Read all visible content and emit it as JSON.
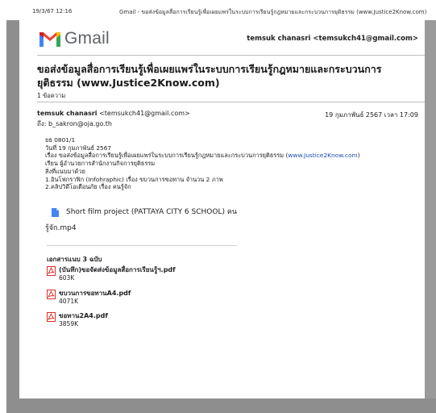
{
  "print_header": {
    "timestamp": "19/3/67 12:16",
    "title": "Gmail - ขอส่งข้อมูลสื่อการเรียนรู้เพื่อเผยแพร่ในระบบการเรียนรู้กฎหมายและกระบวนการยุติธรรม (www.Justice2Know.com)"
  },
  "gmail": {
    "brand": "Gmail",
    "account": "temsuk chanasri <temsukch41@gmail.com>"
  },
  "thread": {
    "subject": "ขอส่งข้อมูลสื่อการเรียนรู้เพื่อเผยแพร่ในระบบการเรียนรู้กฎหมายและกระบวนการยุติธรรม (www.Justice2Know.com)",
    "message_count": "1 ข้อความ"
  },
  "message": {
    "sender_name": "temsuk chanasri",
    "sender_email": "<temsukch41@gmail.com>",
    "date": "19 กุมภาพันธ์ 2567 เวลา 17:09",
    "to": "ถึง: b_sakron@oja.go.th",
    "body": {
      "line1": "ยธ 0801/1",
      "line2": "วันที่ 19 กุมภาพันธ์ 2567",
      "line3_prefix": "เรื่อง ขอส่งข้อมูลสื่อการเรียนรู้เพื่อเผยแพร่ในระบบการเรียนรู้กฎหมายและกระบวนการยุติธรรม (",
      "line3_link": "www.Justice2Know.com",
      "line3_suffix": ")",
      "line4": "เรียน ผู้อำนวยการสำนักงานกิจการยุติธรรม",
      "line5": "สิ่งที่แนบมาด้วย",
      "line6": "1.อินโฟกราฟิก (Infohraphic) เรื่อง ขบวนการขอทาน จำนวน 2 ภาพ",
      "line7": "2.คลิปวิดีโอเตือนภัย เรื่อง คนรู้จัก"
    },
    "drive_attachment": {
      "name_line1": "Short film project (PATTAYA CITY 6 SCHOOL) คน",
      "name_line2": "รู้จัก.mp4"
    },
    "attachments_heading": "เอกสารแนบ 3 ฉบับ",
    "attachments": [
      {
        "name": "(บันทึก)ขอจัดส่งข้อมูลสื่อการเรียนรู้ฯ.pdf",
        "size": "603K"
      },
      {
        "name": "ขบวนการขอทานA4.pdf",
        "size": "4071K"
      },
      {
        "name": "ขอทาน2A4.pdf",
        "size": "3859K"
      }
    ]
  },
  "icons": {
    "logo": "gmail-m-logo-icon",
    "drive_file": "video-file-icon",
    "pdf": "pdf-file-icon"
  },
  "colors": {
    "gmail_red": "#d93025",
    "drive_blue": "#4285f4",
    "link": "#1a4bb3"
  }
}
